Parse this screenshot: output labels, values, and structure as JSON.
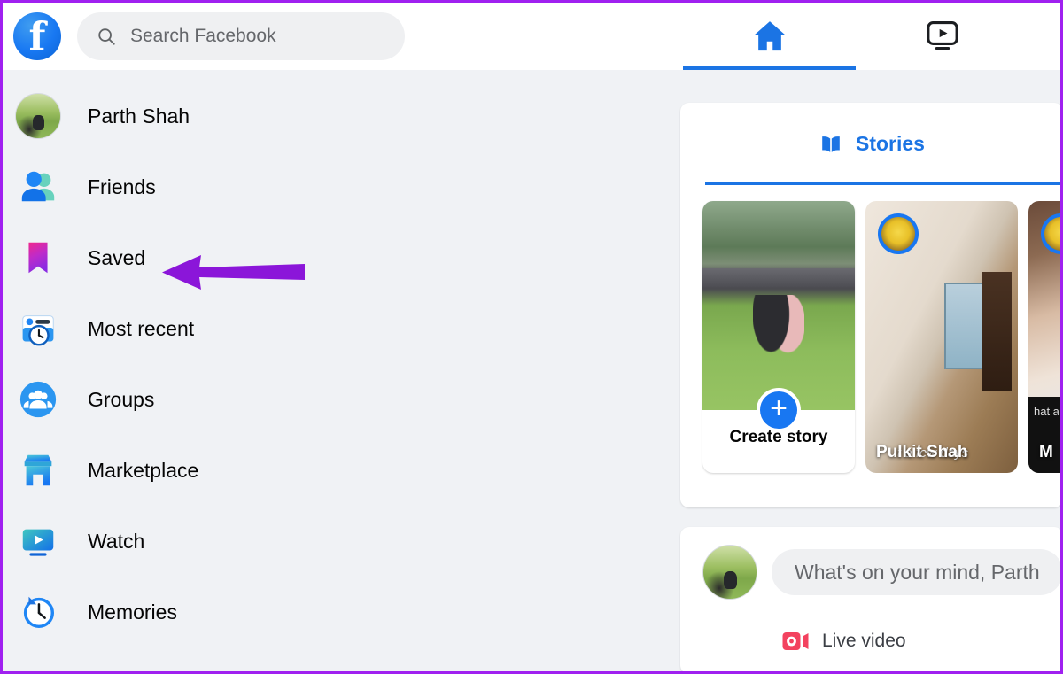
{
  "header": {
    "logo_icon": "facebook-logo",
    "search": {
      "icon": "search-icon",
      "placeholder": "Search Facebook",
      "value": ""
    },
    "nav_tabs": [
      {
        "label": "Home",
        "icon": "home-icon",
        "active": true
      },
      {
        "label": "Watch",
        "icon": "watch-video-icon",
        "active": false
      }
    ]
  },
  "sidebar": {
    "items": [
      {
        "label": "Parth Shah",
        "icon": "profile-avatar"
      },
      {
        "label": "Friends",
        "icon": "friends-icon"
      },
      {
        "label": "Saved",
        "icon": "saved-bookmark-icon"
      },
      {
        "label": "Most recent",
        "icon": "most-recent-icon"
      },
      {
        "label": "Groups",
        "icon": "groups-icon"
      },
      {
        "label": "Marketplace",
        "icon": "marketplace-icon"
      },
      {
        "label": "Watch",
        "icon": "watch-icon"
      },
      {
        "label": "Memories",
        "icon": "memories-clock-icon"
      }
    ]
  },
  "annotation": {
    "type": "arrow",
    "points_to": "Saved",
    "color": "#8b16d9"
  },
  "stories": {
    "tab_label": "Stories",
    "tab_icon": "book-icon",
    "tab_active": true,
    "cards": [
      {
        "type": "create",
        "label": "Create story",
        "button_icon": "plus-icon"
      },
      {
        "type": "story",
        "name": "Pulkit Shah",
        "overlay_text": "t a few days",
        "avatar": "story-avatar"
      },
      {
        "type": "story",
        "name": "M",
        "overlay_text": "hat a love",
        "avatar": "story-avatar"
      }
    ]
  },
  "composer": {
    "avatar": "user-avatar",
    "placeholder": "What's on your mind, Parth",
    "actions": [
      {
        "label": "Live video",
        "icon": "live-video-icon",
        "color": "#f3425f"
      }
    ]
  },
  "colors": {
    "brand_blue": "#1877f2",
    "active_blue": "#1b74e4",
    "page_bg": "#f0f2f5",
    "card_bg": "#ffffff",
    "annotation_purple": "#8b16d9",
    "frame_purple": "#a020f0"
  }
}
